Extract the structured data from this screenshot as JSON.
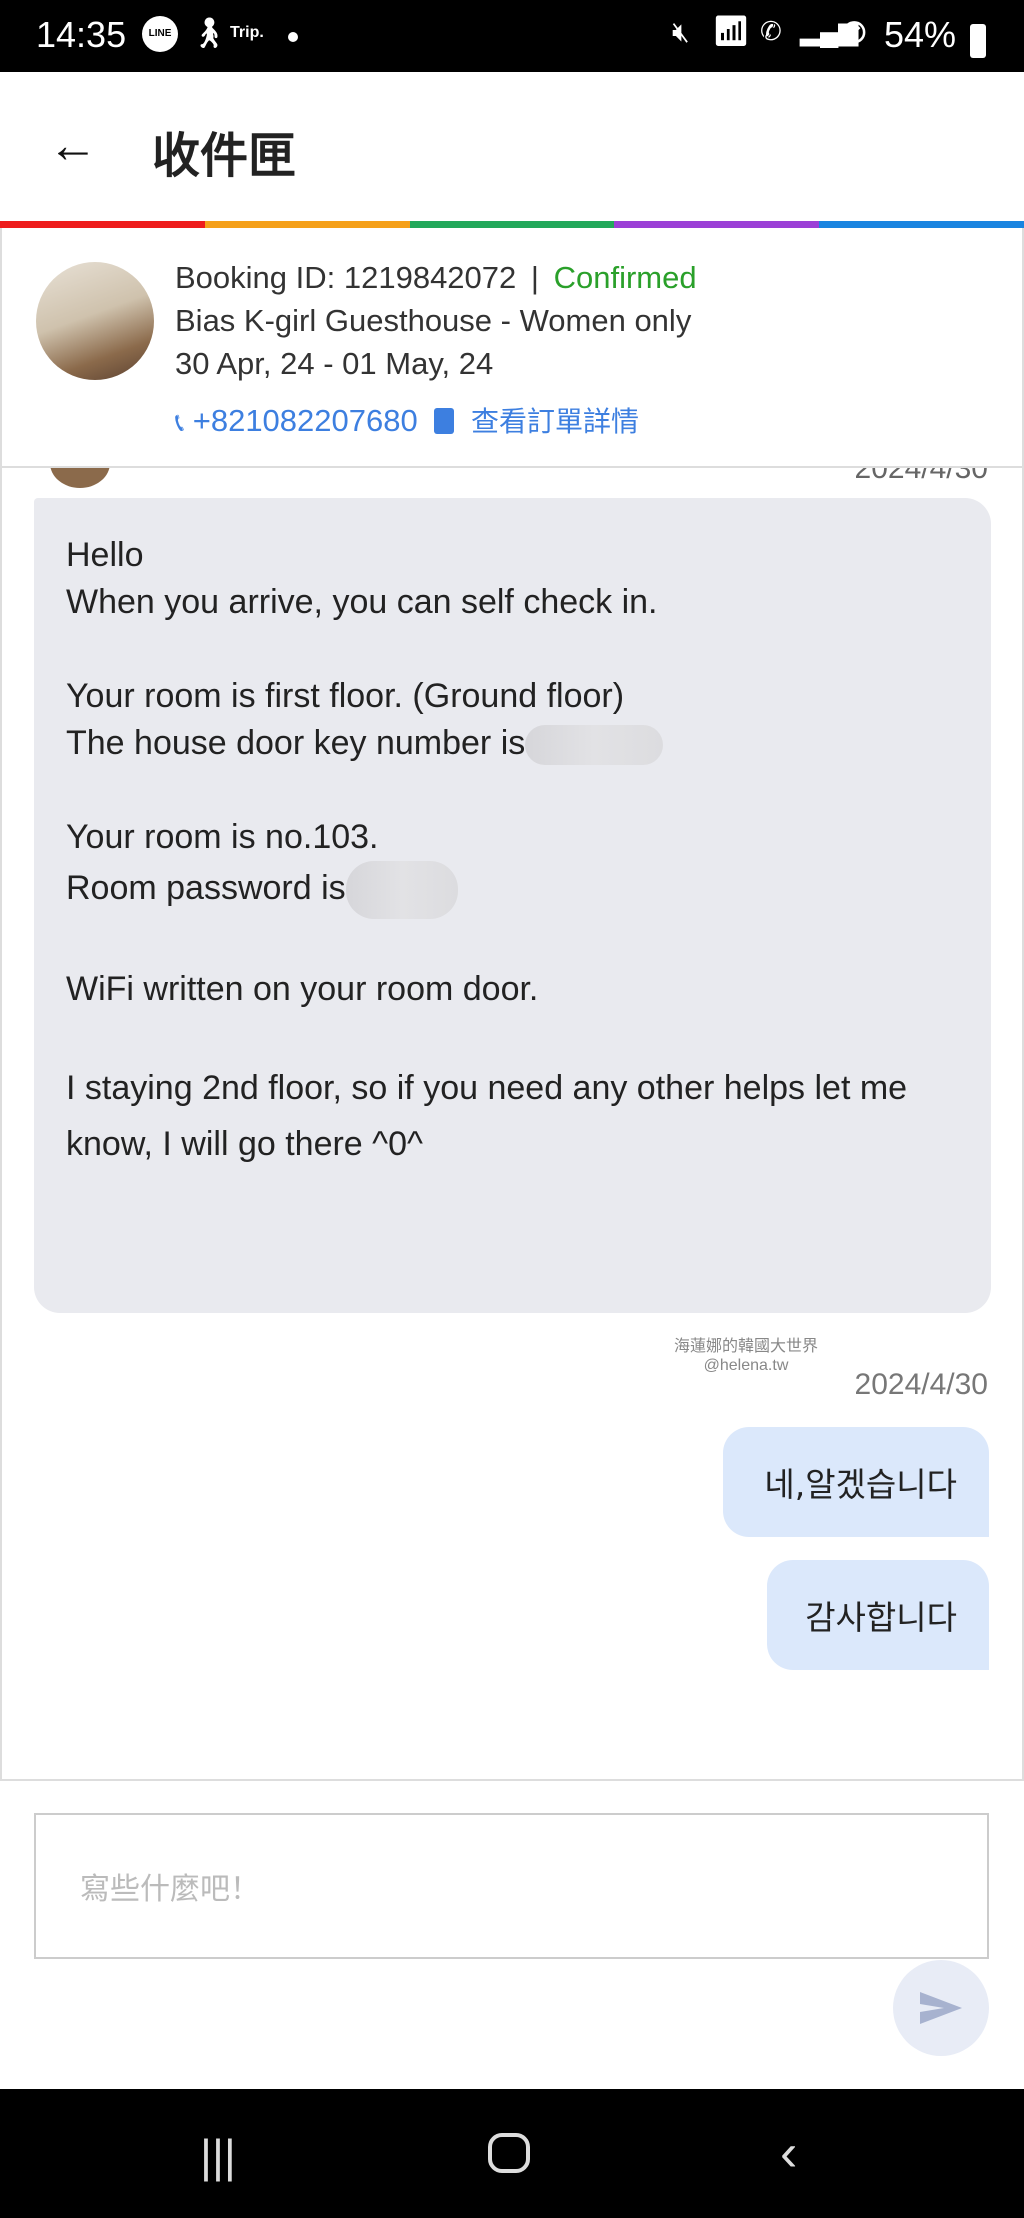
{
  "status_bar": {
    "time": "14:35",
    "notif_icons": [
      "line-icon",
      "walking-icon",
      "trip-icon",
      "dot-icon"
    ],
    "trip_label": "Trip.",
    "line_label": "LINE",
    "battery": "54%"
  },
  "header": {
    "title": "收件匣"
  },
  "stripe_colors": [
    "#ee1c1c",
    "#f5a01a",
    "#22a85a",
    "#9b3fd6",
    "#1a84e0"
  ],
  "booking": {
    "id_label": "Booking ID: 1219842072",
    "separator": "|",
    "status": "Confirmed",
    "status_color": "#2aa02a",
    "hotel": "Bias K-girl Guesthouse - Women only",
    "dates": "30 Apr, 24 - 01 May, 24",
    "phone": "+821082207680",
    "details_link": "查看訂單詳情"
  },
  "chat": {
    "top_timestamp": "2024/4/30",
    "host_message": {
      "lines": [
        "Hello",
        "When you arrive, you can self check in.",
        "",
        "Your room is first floor. (Ground floor)",
        "The house door key number is",
        "",
        "Your room is no.103.",
        "Room password is",
        "",
        "WiFi written on your room door.",
        "",
        "I staying 2nd floor, so if you need any other helps let me know, I will go there ^0^"
      ]
    },
    "watermark": [
      "海蓮娜的韓國大世界",
      "@helena.tw"
    ],
    "timestamp": "2024/4/30",
    "user_messages": [
      "네,알겠습니다",
      "감사합니다"
    ]
  },
  "composer": {
    "placeholder": "寫些什麼吧！"
  }
}
